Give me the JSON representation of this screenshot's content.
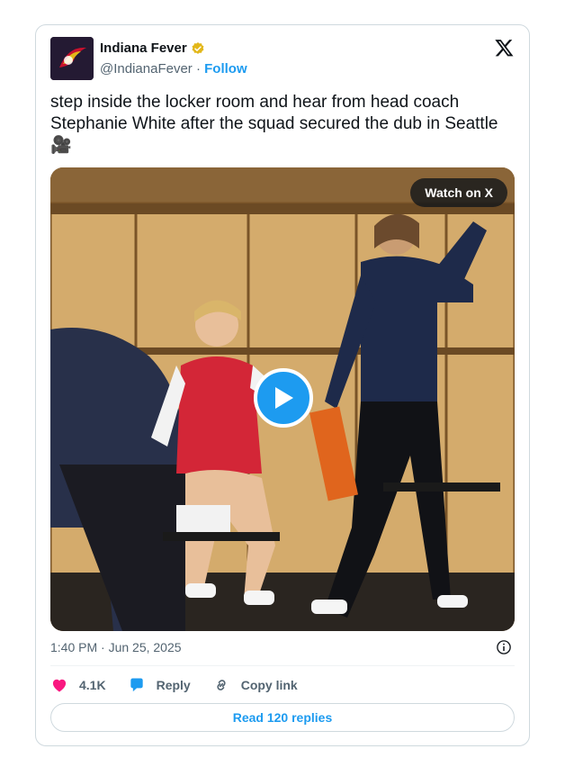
{
  "author": {
    "display_name": "Indiana Fever",
    "handle": "@IndianaFever",
    "separator": " · ",
    "follow_label": "Follow",
    "verified_color": "#e2b719"
  },
  "tweet": {
    "text": "step inside the locker room and hear from head coach Stephanie White after the squad secured the dub in Seattle 🎥"
  },
  "media": {
    "watch_label": "Watch on X"
  },
  "meta": {
    "timestamp": "1:40 PM · Jun 25, 2025"
  },
  "actions": {
    "likes_count": "4.1K",
    "reply_label": "Reply",
    "copy_link_label": "Copy link"
  },
  "footer": {
    "read_replies_label": "Read 120 replies"
  },
  "colors": {
    "accent": "#1d9bf0",
    "heart": "#f91880",
    "text": "#0f1419",
    "muted": "#536471",
    "border": "#cfd9de"
  }
}
